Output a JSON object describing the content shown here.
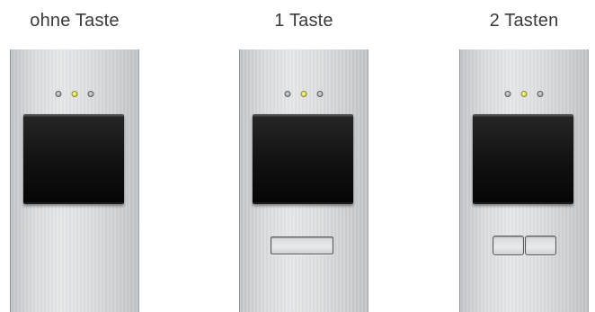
{
  "variants": [
    {
      "label": "ohne Taste",
      "buttons": 0
    },
    {
      "label": "1 Taste",
      "buttons": 1
    },
    {
      "label": "2 Tasten",
      "buttons": 2
    }
  ],
  "leds": {
    "count": 3,
    "active_index": 1,
    "active_color": "#f1f07a",
    "idle_color": "#b9bbbd"
  },
  "colors": {
    "panel": "#d9dbdd",
    "camera_window": "#111111",
    "label_text": "#3a3a3a"
  }
}
